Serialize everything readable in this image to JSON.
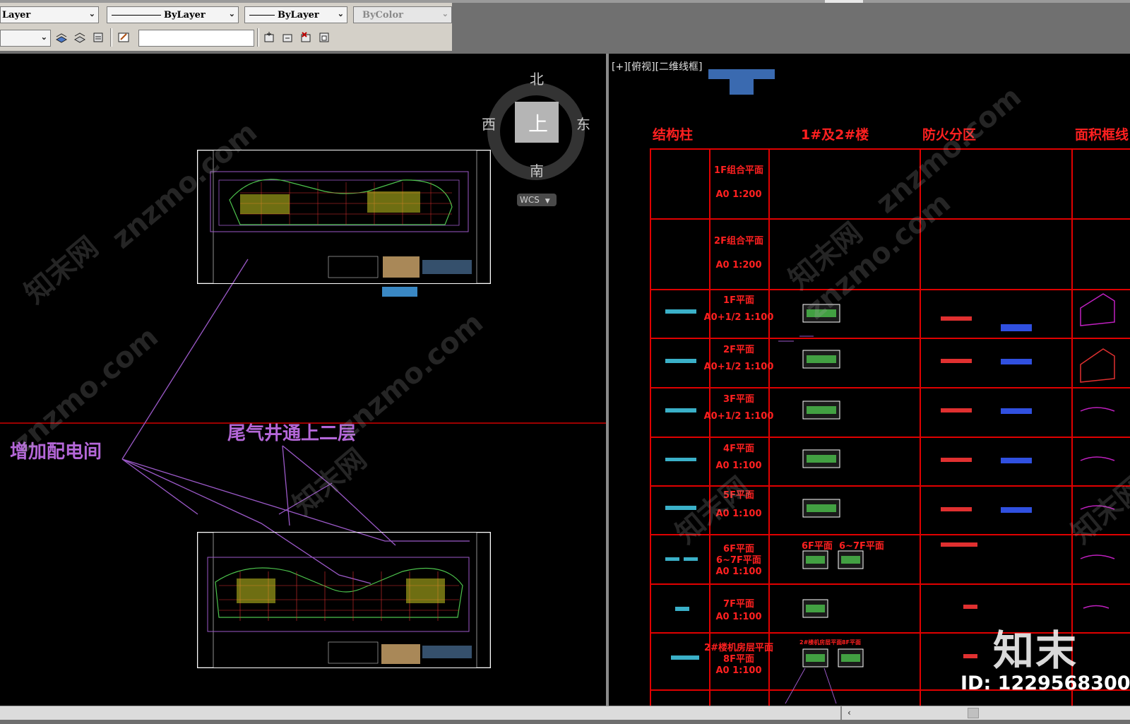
{
  "toolbar": {
    "layer_combo": "Layer",
    "linetype_combo": "ByLayer",
    "lineweight_combo": "ByLayer",
    "color_combo": "ByColor"
  },
  "left_view": {
    "compass": {
      "north": "北",
      "east": "东",
      "south": "南",
      "west": "西",
      "top": "上",
      "wcs": "WCS"
    },
    "annotations": {
      "add_room": "增加配电间",
      "exhaust": "尾气井通上二层"
    }
  },
  "right_view": {
    "viewport_label": "[+][俯视][二维线框]",
    "headers": [
      "结构柱",
      "1#及2#楼",
      "防火分区",
      "面积框线"
    ],
    "rows": [
      {
        "line1": "1F组合平面",
        "line2": "A0 1:200"
      },
      {
        "line1": "2F组合平面",
        "line2": "A0 1:200"
      },
      {
        "line1": "1F平面",
        "line2": "A0+1/2 1:100"
      },
      {
        "line1": "2F平面",
        "line2": "A0+1/2 1:100"
      },
      {
        "line1": "3F平面",
        "line2": "A0+1/2 1:100"
      },
      {
        "line1": "4F平面",
        "line2": "A0 1:100"
      },
      {
        "line1": "5F平面",
        "line2": "A0 1:100"
      },
      {
        "line1": "6F平面",
        "line2": "6~7F平面",
        "line3": "A0 1:100"
      },
      {
        "line1": "7F平面",
        "line2": "A0 1:100"
      },
      {
        "line1": "2#楼机房层平面",
        "line2": "8F平面",
        "line3": "A0 1:100"
      }
    ],
    "row7_sub_labels": [
      "6F平面",
      "6~7F平面"
    ],
    "row10_sub_labels": [
      "2#楼机房层平面",
      "8F平面"
    ]
  },
  "watermark": {
    "site": "znzmo.com",
    "brand_cn": "知末网",
    "logo": "知末",
    "id_text": "ID: 1229568300"
  }
}
